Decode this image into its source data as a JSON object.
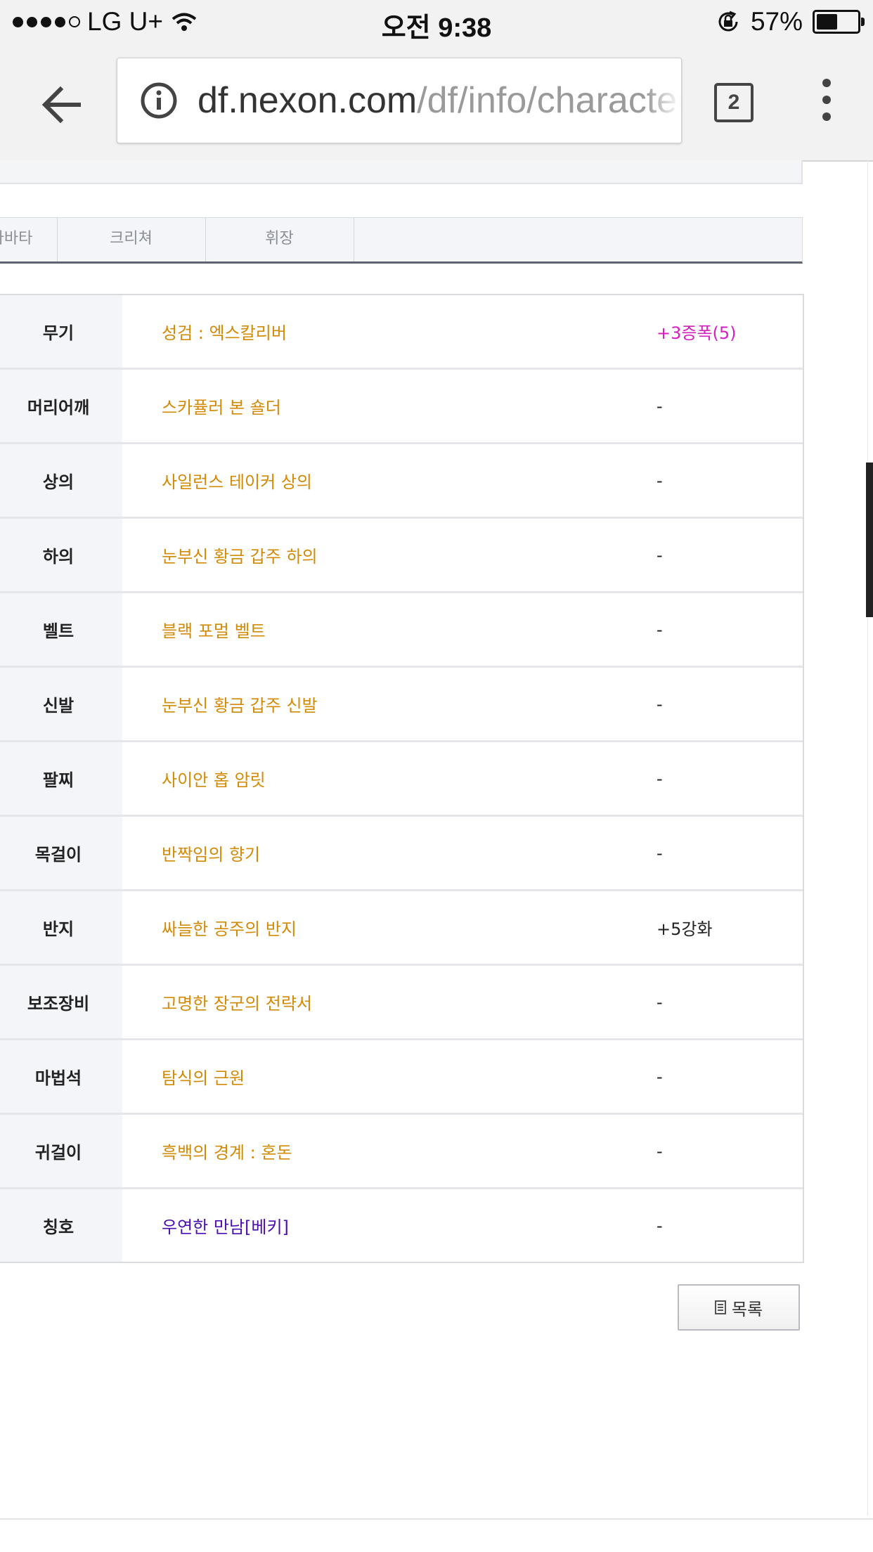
{
  "status_bar": {
    "carrier": "LG U+",
    "time": "오전 9:38",
    "battery": "57%",
    "battery_level": 0.57
  },
  "browser": {
    "url_host": "df.nexon.com",
    "url_path": "/df/info/character",
    "tab_count": "2"
  },
  "tabs": [
    {
      "label": "아바타"
    },
    {
      "label": "크리쳐"
    },
    {
      "label": "휘장"
    }
  ],
  "equipment": [
    {
      "slot": "무기",
      "item": "성검 : 엑스칼리버",
      "enhance": "+3증폭(5)",
      "item_color": "#d38a07",
      "enhance_color": "#d61fc0"
    },
    {
      "slot": "머리어깨",
      "item": "스카퓰러 본 숄더",
      "enhance": "-"
    },
    {
      "slot": "상의",
      "item": "사일런스 테이커 상의",
      "enhance": "-"
    },
    {
      "slot": "하의",
      "item": "눈부신 황금 갑주 하의",
      "enhance": "-"
    },
    {
      "slot": "벨트",
      "item": "블랙 포멀 벨트",
      "enhance": "-"
    },
    {
      "slot": "신발",
      "item": "눈부신 황금 갑주 신발",
      "enhance": "-"
    },
    {
      "slot": "팔찌",
      "item": "사이안 홉 암릿",
      "enhance": "-"
    },
    {
      "slot": "목걸이",
      "item": "반짝임의 향기",
      "enhance": "-"
    },
    {
      "slot": "반지",
      "item": "싸늘한 공주의 반지",
      "enhance": "+5강화"
    },
    {
      "slot": "보조장비",
      "item": "고명한 장군의 전략서",
      "enhance": "-"
    },
    {
      "slot": "마법석",
      "item": "탐식의 근원",
      "enhance": "-"
    },
    {
      "slot": "귀걸이",
      "item": "흑백의 경계 : 혼돈",
      "enhance": "-"
    },
    {
      "slot": "칭호",
      "item": "우연한 만남[베키]",
      "enhance": "-",
      "item_color": "#4b0fb0"
    }
  ],
  "list_button": {
    "label": "목록"
  },
  "colors": {
    "epic_item": "#d38a07",
    "title_item": "#4b0fb0",
    "amplified": "#d61fc0"
  }
}
